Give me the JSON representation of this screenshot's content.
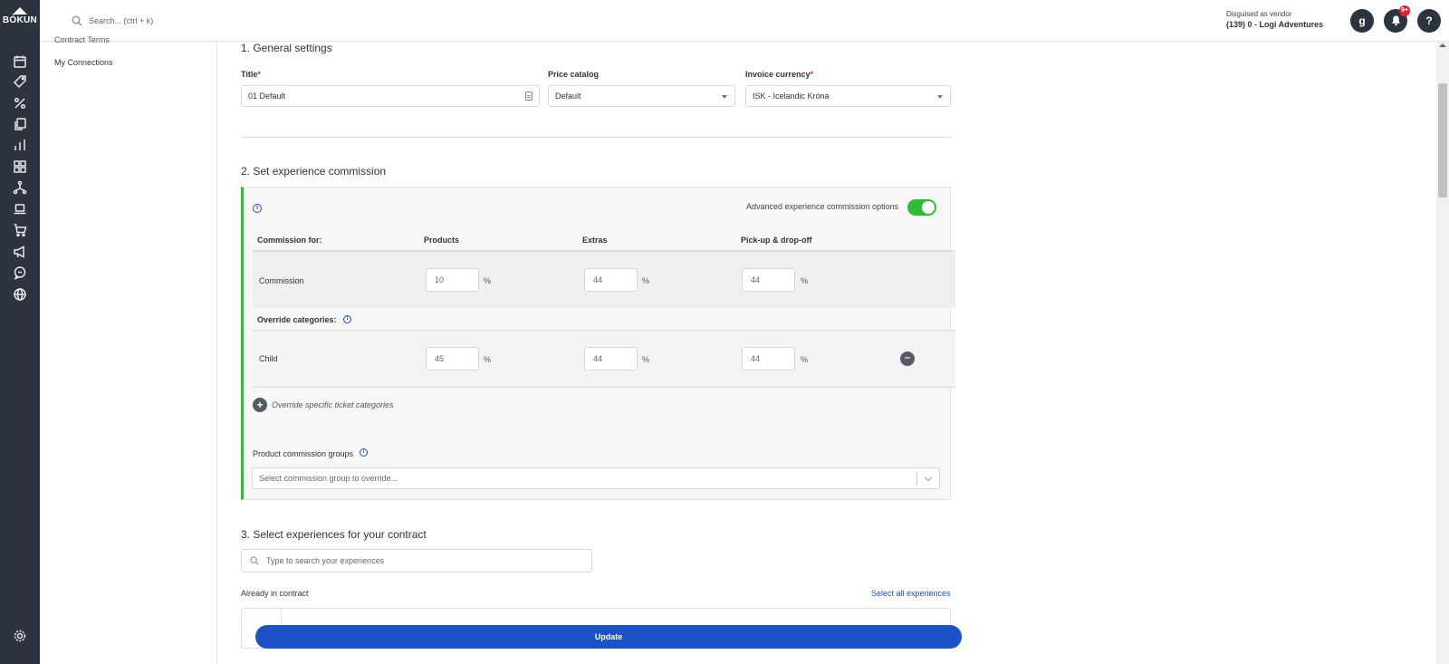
{
  "brand": {
    "logo_text": "BÓKUN"
  },
  "header": {
    "search_placeholder": "Search... (ctrl + k)",
    "vendor_label": "Disguised as vendor",
    "vendor_name": "(139) 0 - Logi Adventures",
    "avatar_letter": "g",
    "notification_count": "9+",
    "help_label": "?"
  },
  "sidenav": {
    "cut_item": "Contract Terms",
    "items": [
      "My Connections"
    ]
  },
  "general": {
    "heading": "1. General settings",
    "title_label": "Title",
    "title_value": "01 Default",
    "price_catalog_label": "Price catalog",
    "price_catalog_value": "Default",
    "invoice_currency_label": "Invoice currency",
    "invoice_currency_value": "ISK - Icelandic Króna",
    "required_mark": "*"
  },
  "commission": {
    "heading": "2. Set experience commission",
    "advanced_label": "Advanced experience commission options",
    "advanced_enabled": true,
    "columns": [
      "Commission for:",
      "Products",
      "Extras",
      "Pick-up & drop-off"
    ],
    "commission_row": {
      "label": "Commission",
      "products": "10",
      "extras": "44",
      "pickup": "44"
    },
    "override_label": "Override categories:",
    "override_rows": [
      {
        "label": "Child",
        "products": "45",
        "extras": "44",
        "pickup": "44"
      }
    ],
    "percent_sign": "%",
    "override_specific_label": "Override specific ticket categories",
    "groups_label": "Product commission groups",
    "groups_placeholder": "Select commission group to override..."
  },
  "experiences": {
    "heading": "3. Select experiences for your contract",
    "search_placeholder": "Type to search your experiences",
    "already_label": "Already in contract",
    "select_all_label": "Select all experiences"
  },
  "actions": {
    "update_label": "Update"
  },
  "colors": {
    "accent_green": "#2fbb35",
    "primary_blue": "#1b52c6",
    "rail": "#2c3440"
  }
}
